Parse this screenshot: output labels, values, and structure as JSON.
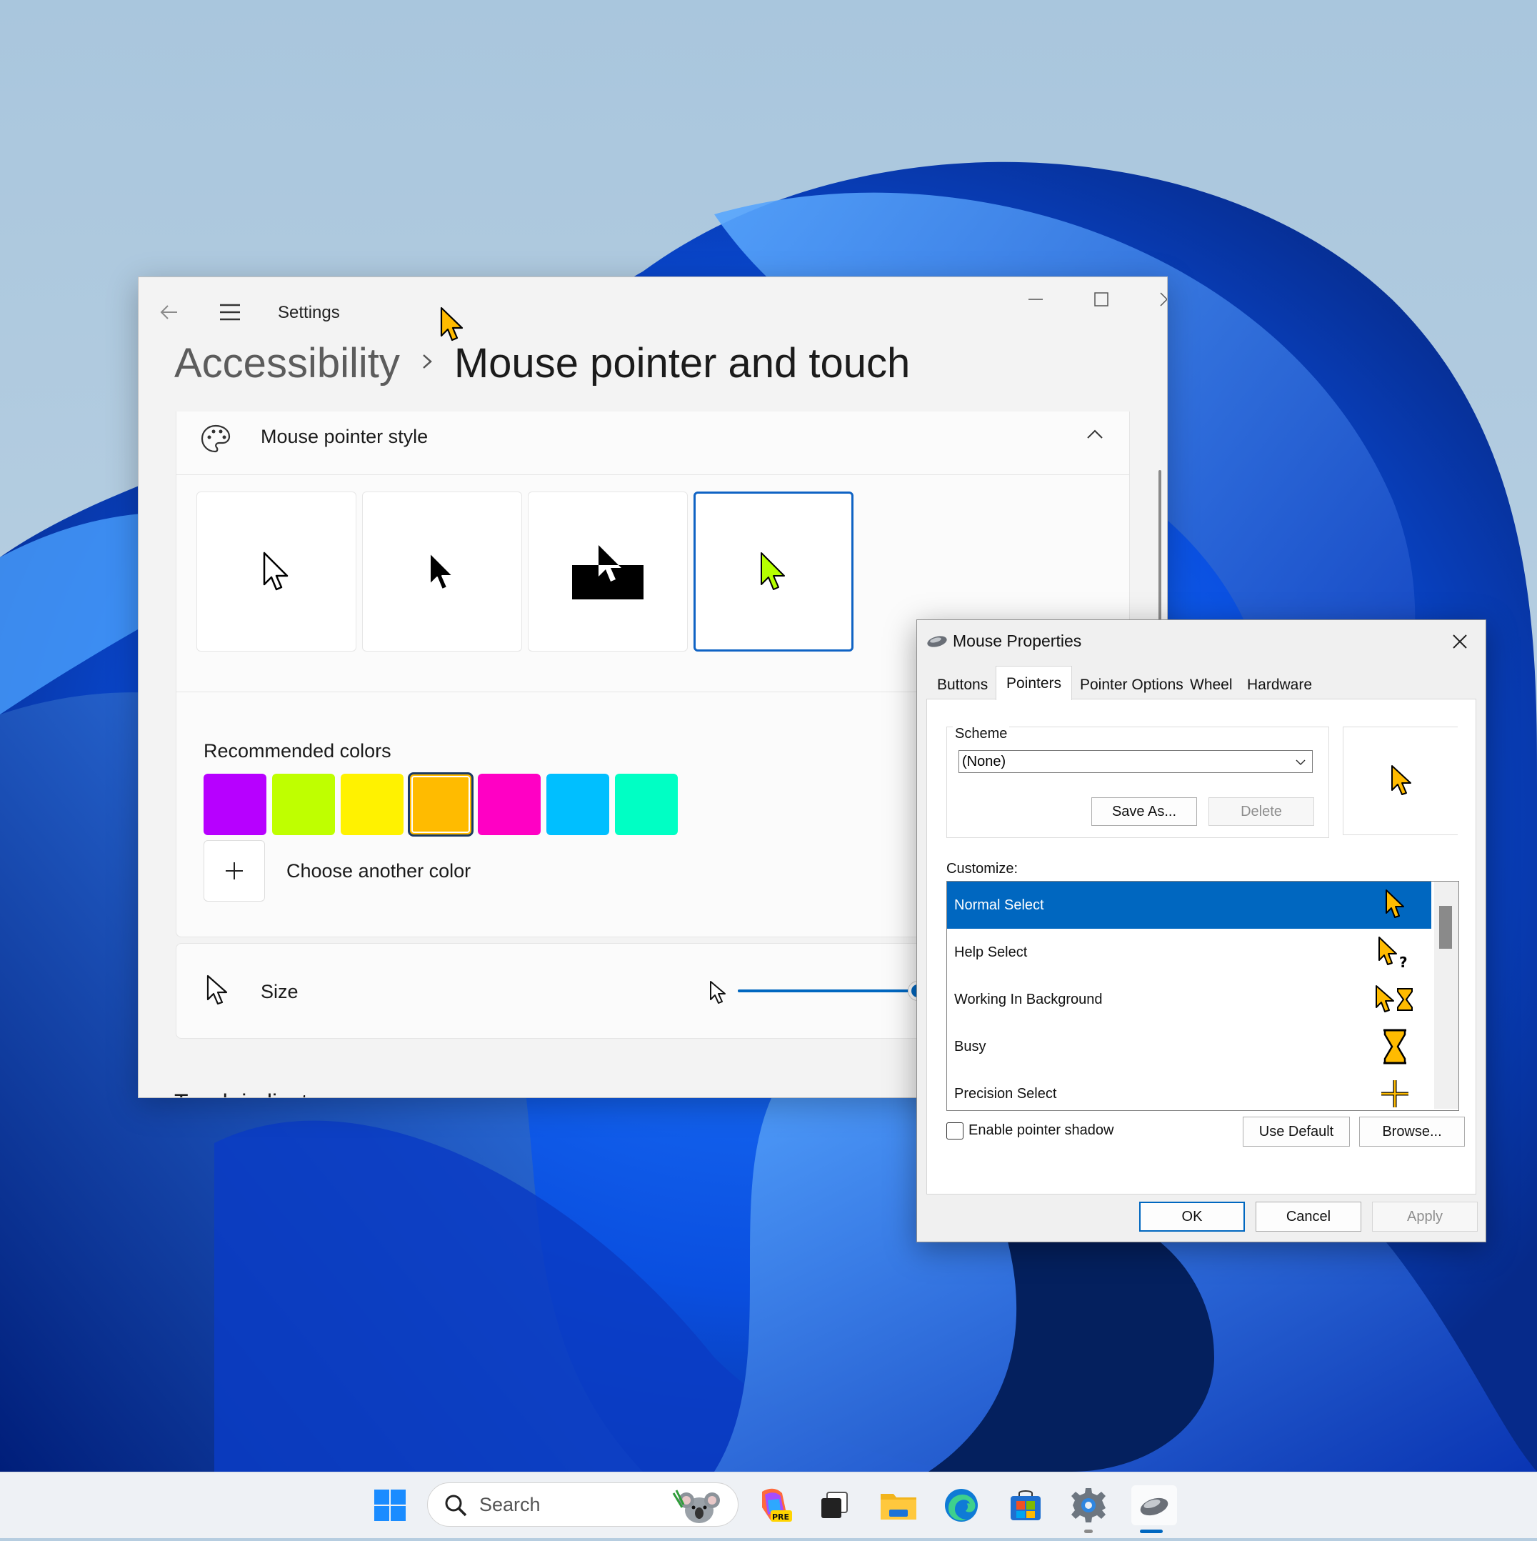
{
  "settings": {
    "app_title": "Settings",
    "breadcrumb_parent": "Accessibility",
    "breadcrumb_current": "Mouse pointer and touch",
    "pointer_style_header": "Mouse pointer style",
    "pointer_styles": [
      "white",
      "black",
      "inverted",
      "custom"
    ],
    "selected_style": "custom",
    "recommended_colors_label": "Recommended colors",
    "recommended_colors": [
      "#b700ff",
      "#bfff00",
      "#fff200",
      "#ffbb00",
      "#ff00c4",
      "#00bfff",
      "#00ffc4"
    ],
    "selected_color": "#ffbb00",
    "choose_color_label": "Choose another color",
    "size_label": "Size",
    "size_level": 0.45,
    "next_section_partial": "Touch indicator"
  },
  "mouse_dialog": {
    "title": "Mouse Properties",
    "tabs": [
      "Buttons",
      "Pointers",
      "Pointer Options",
      "Wheel",
      "Hardware"
    ],
    "active_tab": "Pointers",
    "scheme_label": "Scheme",
    "scheme_value": "(None)",
    "save_as_label": "Save As...",
    "delete_label": "Delete",
    "customize_label": "Customize:",
    "cursor_list": [
      {
        "name": "Normal Select",
        "icon": "arrow-cursor-icon"
      },
      {
        "name": "Help Select",
        "icon": "help-cursor-icon"
      },
      {
        "name": "Working In Background",
        "icon": "working-cursor-icon"
      },
      {
        "name": "Busy",
        "icon": "hourglass-cursor-icon"
      },
      {
        "name": "Precision Select",
        "icon": "crosshair-cursor-icon"
      }
    ],
    "selected_cursor": "Normal Select",
    "enable_shadow_label": "Enable pointer shadow",
    "enable_shadow_checked": false,
    "use_default_label": "Use Default",
    "browse_label": "Browse...",
    "ok_label": "OK",
    "cancel_label": "Cancel",
    "apply_label": "Apply"
  },
  "taskbar": {
    "search_placeholder": "Search",
    "pinned": [
      "start-icon",
      "copilot-icon",
      "task-view-icon",
      "file-explorer-icon",
      "edge-icon",
      "store-icon",
      "settings-icon",
      "mouse-properties-icon"
    ],
    "active_app": "mouse-properties-icon"
  },
  "colors": {
    "accent": "#0067c0",
    "cursor_fill": "#ffbb00"
  }
}
